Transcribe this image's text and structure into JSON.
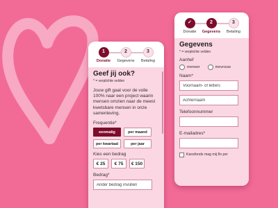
{
  "colors": {
    "background": "#f26b97",
    "accent": "#7d0d2c",
    "panel": "#fbd6e3"
  },
  "phone1": {
    "steps": [
      {
        "num": "1",
        "label": "Donatie"
      },
      {
        "num": "2",
        "label": "Gegevens"
      },
      {
        "num": "3",
        "label": "Betaling"
      }
    ],
    "title": "Geef jij ook?",
    "required_note": "* = verplichte velden",
    "paragraph": "Jouw gift gaat voor de volle 100% naar een project waarin mensen omzien naar de meest kwetsbare mensen in onze samenleving.",
    "frequency_label": "Frequentie*",
    "frequency_options": [
      "eenmalig",
      "per maand",
      "per kwartaal",
      "per jaar"
    ],
    "amount_label": "Kies een bedrag",
    "amounts": [
      "€ 25",
      "€ 75",
      "€ 150"
    ],
    "custom_label": "Bedrag*",
    "custom_placeholder": "Ander bedrag invullen"
  },
  "phone2": {
    "steps": [
      {
        "num": "✓",
        "label": "Donatie"
      },
      {
        "num": "2",
        "label": "Gegevens"
      },
      {
        "num": "3",
        "label": "Betaling"
      }
    ],
    "title": "Gegevens",
    "required_note": "* = verplichte velden",
    "salutation_label": "Aanhef",
    "salutation_options": [
      "meneer",
      "mevrouw"
    ],
    "name_label": "Naam*",
    "first_name_placeholder": "Voornaam- of letters",
    "last_name_placeholder": "Achternaam",
    "phone_label": "Telefoonnummer",
    "email_label": "E-mailadres*",
    "consent_text": "Kansfonds mag mij 8x per"
  }
}
